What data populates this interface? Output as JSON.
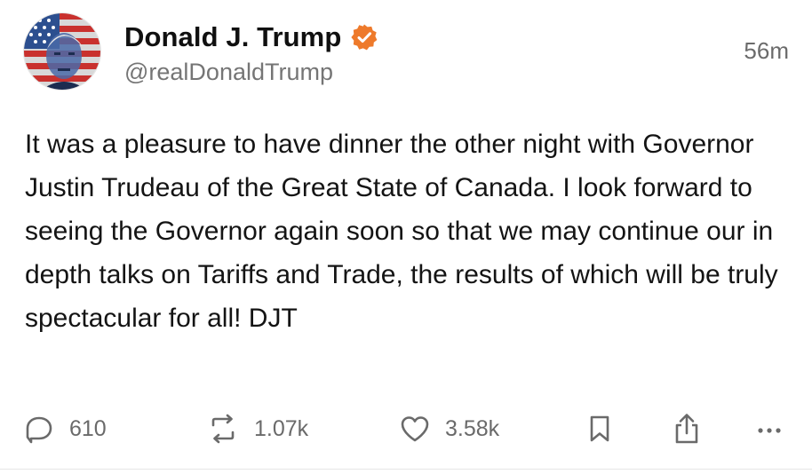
{
  "post": {
    "author_name": "Donald J. Trump",
    "handle": "@realDonaldTrump",
    "time_ago": "56m",
    "text": "It was a pleasure to have dinner the other night with Governor Justin Trudeau of the Great State of Canada. I look forward to seeing the Governor again soon so that we may continue our in depth talks on Tariffs and Trade, the results of which will be truly spectacular for all! DJT",
    "verified_badge_color": "#ee7a2b"
  },
  "actions": {
    "replies": {
      "icon": "reply-icon",
      "count": "610"
    },
    "reposts": {
      "icon": "repost-icon",
      "count": "1.07k"
    },
    "likes": {
      "icon": "heart-icon",
      "count": "3.58k"
    },
    "bookmark": {
      "icon": "bookmark-icon"
    },
    "share": {
      "icon": "share-icon"
    },
    "more": {
      "icon": "more-icon"
    }
  },
  "colors": {
    "text": "#141414",
    "muted": "#6a6a6a",
    "background": "#ffffff"
  }
}
